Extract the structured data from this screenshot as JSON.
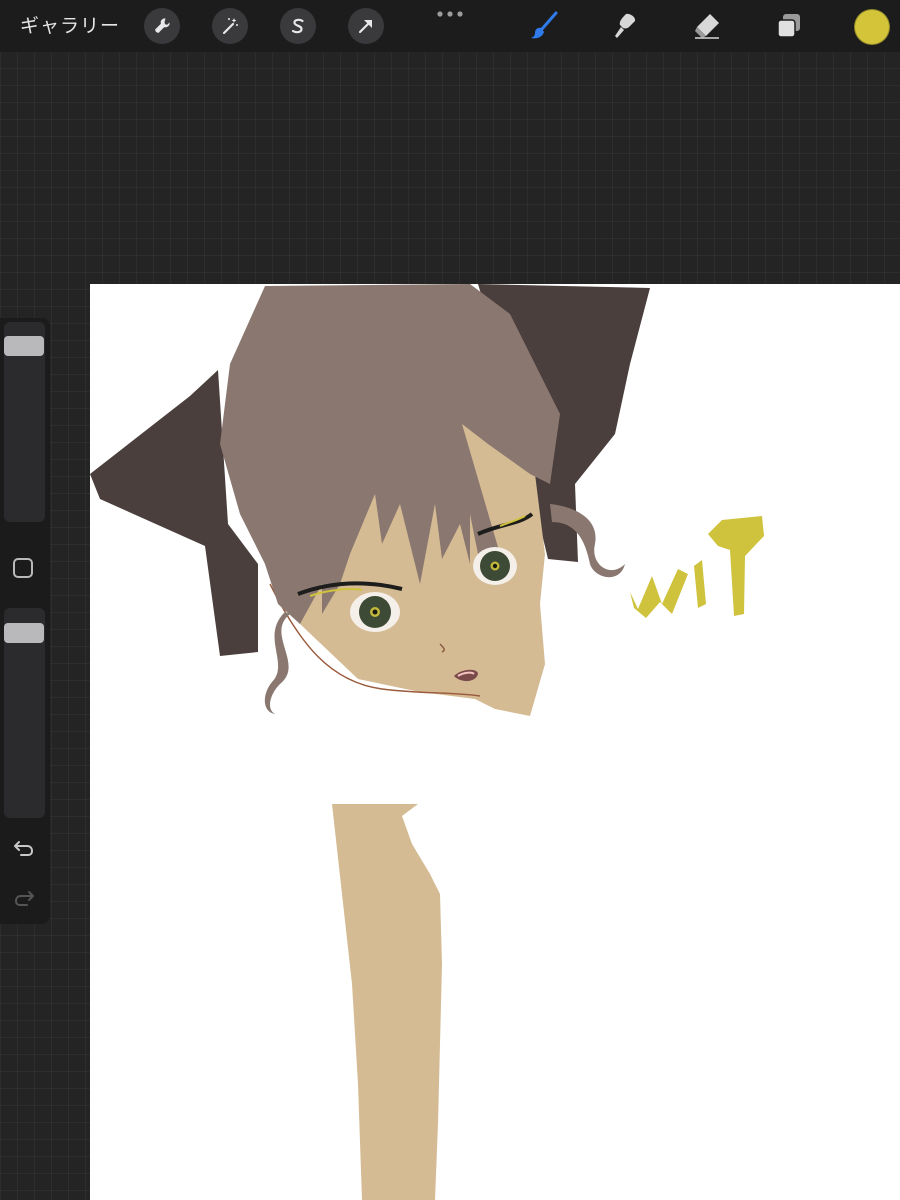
{
  "toolbar": {
    "gallery_label": "ギャラリー",
    "left_tools": [
      {
        "icon": "wrench-icon"
      },
      {
        "icon": "magic-wand-icon"
      },
      {
        "icon": "selection-s-icon"
      },
      {
        "icon": "move-arrow-icon"
      }
    ],
    "more_icon": "more-dots-icon",
    "right_tools": [
      {
        "icon": "brush-icon",
        "active": true
      },
      {
        "icon": "smudge-icon"
      },
      {
        "icon": "eraser-icon"
      },
      {
        "icon": "layers-icon"
      }
    ],
    "current_color": "#d4c43a",
    "active_tool_color": "#2f7bea"
  },
  "sidebar": {
    "brush_size_level": 0.05,
    "opacity_level": 0.05,
    "undo_icon": "undo-icon",
    "redo_icon": "redo-icon"
  },
  "canvas": {
    "background": "#ffffff",
    "artwork": {
      "hair_color": "#8a7870",
      "ribbon_color": "#4a3f3c",
      "skin_color": "#d5bb94",
      "eye_color": "#3d4a35",
      "lettering_color": "#cfc23c",
      "lettering_text": "wip"
    }
  }
}
